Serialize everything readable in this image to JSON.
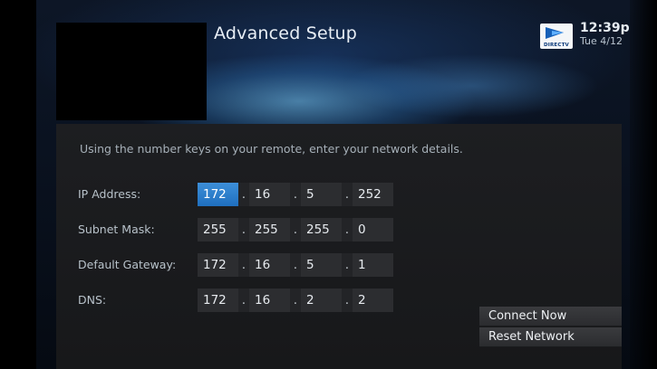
{
  "header": {
    "title": "Advanced Setup",
    "logo_text": "DIRECTV",
    "time": "12:39p",
    "date": "Tue 4/12"
  },
  "instructions": "Using the number keys on your remote, enter your network details.",
  "fields": {
    "ip": {
      "label": "IP Address:",
      "octets": [
        "172",
        "16",
        "5",
        "252"
      ],
      "active_index": 0
    },
    "subnet": {
      "label": "Subnet Mask:",
      "octets": [
        "255",
        "255",
        "255",
        "0"
      ]
    },
    "gateway": {
      "label": "Default Gateway:",
      "octets": [
        "172",
        "16",
        "5",
        "1"
      ]
    },
    "dns": {
      "label": "DNS:",
      "octets": [
        "172",
        "16",
        "2",
        "2"
      ]
    }
  },
  "separator": ".",
  "actions": {
    "connect_now": "Connect Now",
    "reset_network": "Reset Network"
  },
  "colors": {
    "active_field": "#2f80cf",
    "panel": "#1b1c1f",
    "field": "#2c2d30"
  }
}
